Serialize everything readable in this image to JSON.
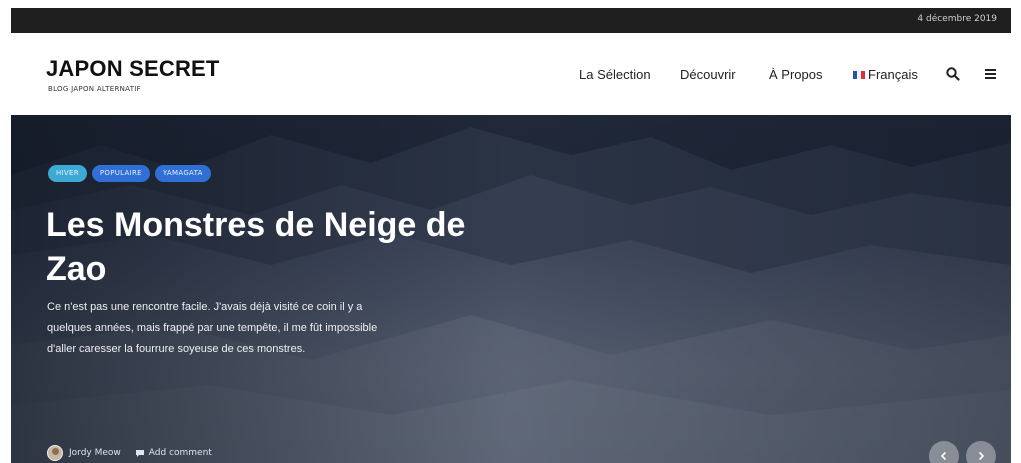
{
  "topbar": {
    "date": "4 décembre 2019"
  },
  "brand": {
    "title": "JAPON SECRET",
    "subtitle": "BLOG JAPON ALTERNATIF"
  },
  "nav": {
    "items": [
      {
        "label": "La Sélection"
      },
      {
        "label": "Découvrir"
      },
      {
        "label": "À Propos"
      }
    ],
    "language": "Français",
    "icons": [
      "search-icon",
      "hamburger-menu-icon"
    ]
  },
  "hero": {
    "tags": [
      {
        "label": "HIVER",
        "color": "#3fa9d6"
      },
      {
        "label": "POPULAIRE",
        "color": "#2f6fd6"
      },
      {
        "label": "YAMAGATA",
        "color": "#2f6fd6"
      }
    ],
    "title": "Les Monstres de Neige de Zao",
    "excerpt": "Ce n'est pas une rencontre facile. J'avais déjà visité ce coin il y a quelques années, mais frappé par une tempête, il me fût impossible d'aller caresser la fourrure soyeuse de ces monstres.",
    "author": "Jordy Meow",
    "comment_label": "Add comment"
  },
  "colors": {
    "topbar": "#1f1f1f",
    "hero_overlay": "#1b2331",
    "tag_light": "#3fa9d6",
    "tag_dark": "#2f6fd6"
  }
}
